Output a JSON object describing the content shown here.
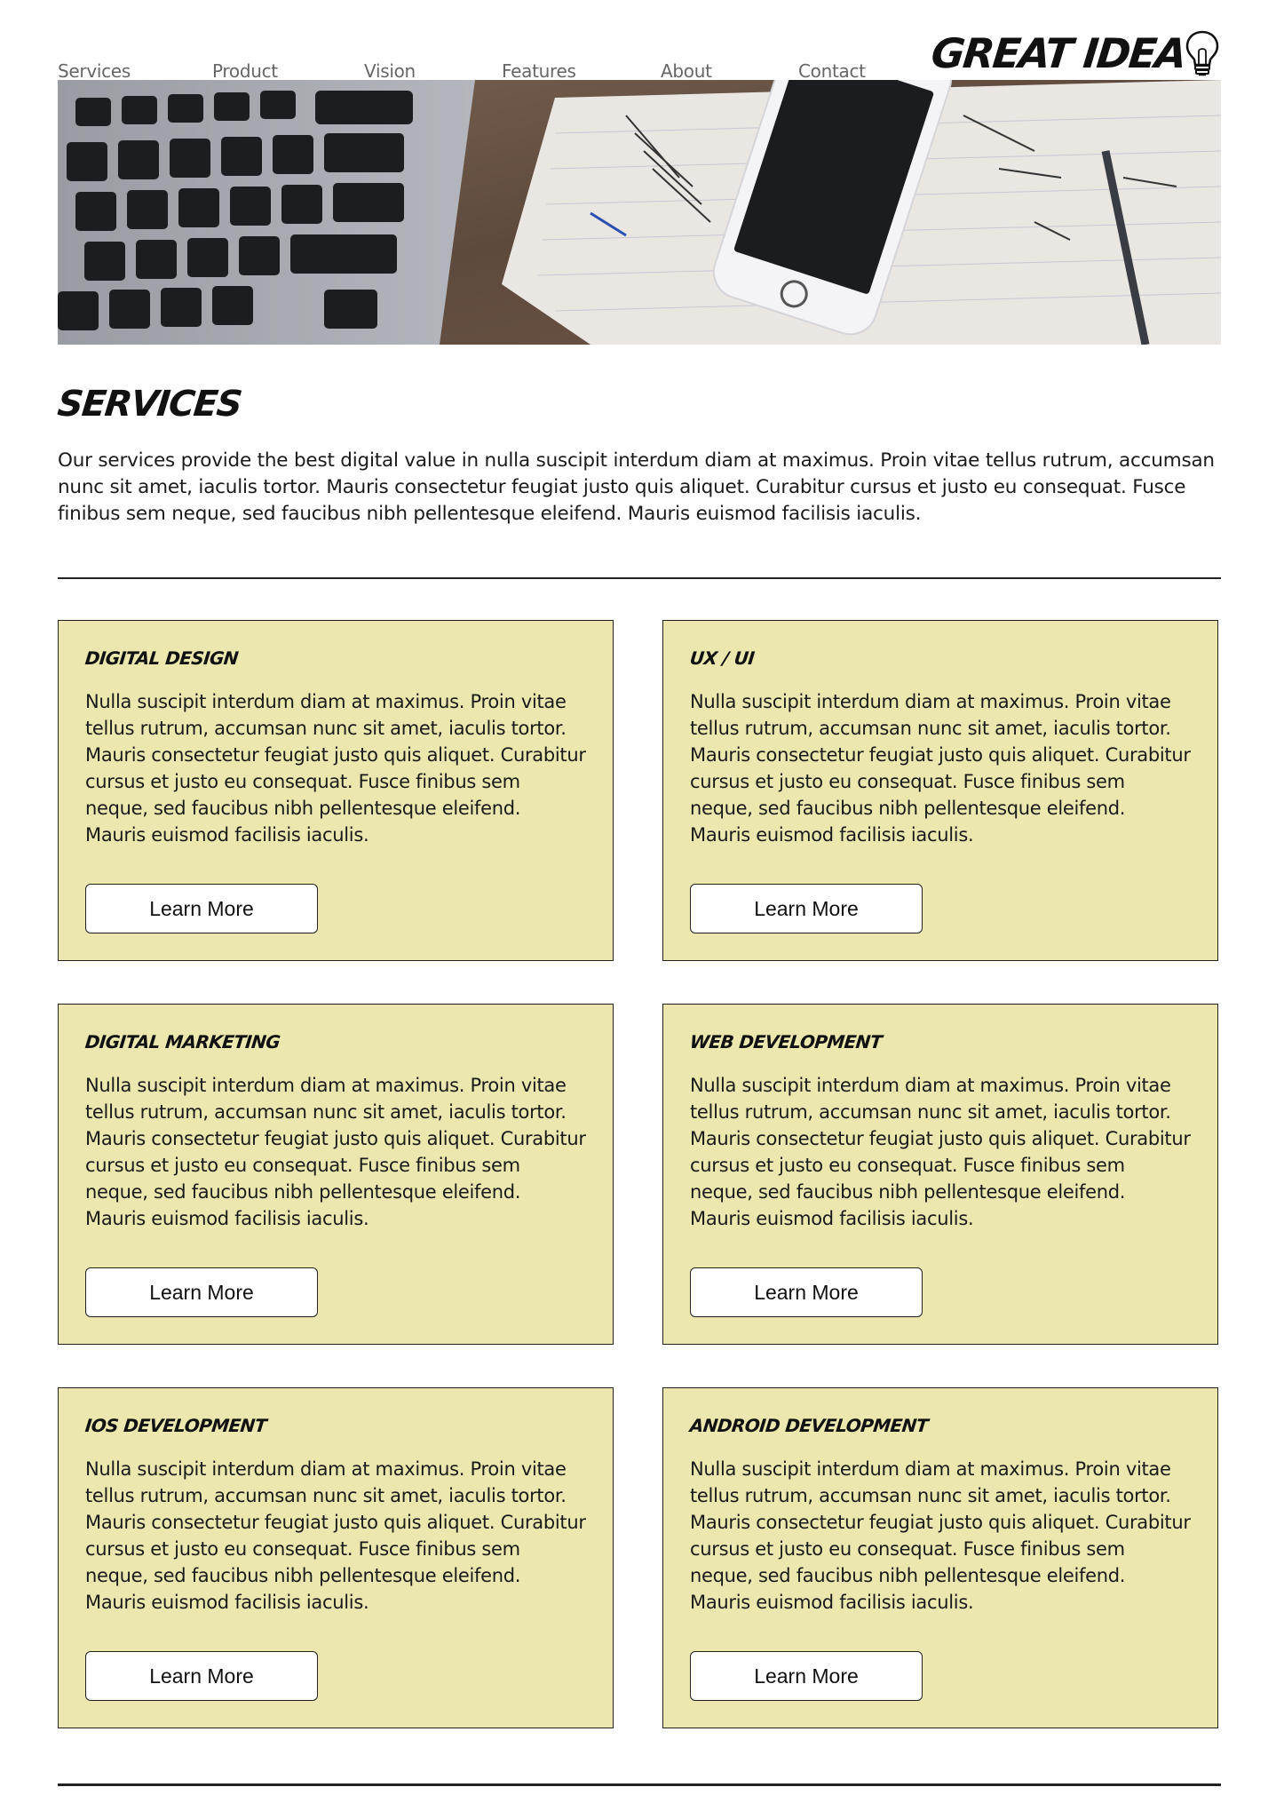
{
  "nav": {
    "items": [
      "Services",
      "Product",
      "Vision",
      "Features",
      "About",
      "Contact"
    ]
  },
  "logo": {
    "text": "GREAT IDEA",
    "icon": "lightbulb-icon"
  },
  "hero": {
    "image": "laptop keyboard, smartphone and handwritten notebook on wooden desk"
  },
  "services": {
    "title": "SERVICES",
    "intro": "Our services provide the best digital value in nulla suscipit interdum diam at maximus. Proin vitae tellus rutrum, accumsan nunc sit amet, iaculis tortor. Mauris consectetur feugiat justo quis aliquet. Curabitur cursus et justo eu consequat. Fusce finibus sem neque, sed faucibus nibh pellentesque eleifend. Mauris euismod facilisis iaculis.",
    "cards": [
      {
        "title": "Digital Design",
        "text": "Nulla suscipit interdum diam at maximus. Proin vitae tellus rutrum, accumsan nunc sit amet, iaculis tortor. Mauris consectetur feugiat justo quis aliquet. Curabitur cursus et justo eu consequat. Fusce finibus sem neque, sed faucibus nibh pellentesque eleifend. Mauris euismod facilisis iaculis.",
        "button": "Learn More"
      },
      {
        "title": "UX / UI",
        "text": "Nulla suscipit interdum diam at maximus. Proin vitae tellus rutrum, accumsan nunc sit amet, iaculis tortor. Mauris consectetur feugiat justo quis aliquet. Curabitur cursus et justo eu consequat. Fusce finibus sem neque, sed faucibus nibh pellentesque eleifend. Mauris euismod facilisis iaculis.",
        "button": "Learn More"
      },
      {
        "title": "Digital Marketing",
        "text": "Nulla suscipit interdum diam at maximus. Proin vitae tellus rutrum, accumsan nunc sit amet, iaculis tortor. Mauris consectetur feugiat justo quis aliquet. Curabitur cursus et justo eu consequat. Fusce finibus sem neque, sed faucibus nibh pellentesque eleifend. Mauris euismod facilisis iaculis.",
        "button": "Learn More"
      },
      {
        "title": "Web Development",
        "text": "Nulla suscipit interdum diam at maximus. Proin vitae tellus rutrum, accumsan nunc sit amet, iaculis tortor. Mauris consectetur feugiat justo quis aliquet. Curabitur cursus et justo eu consequat. Fusce finibus sem neque, sed faucibus nibh pellentesque eleifend. Mauris euismod facilisis iaculis.",
        "button": "Learn More"
      },
      {
        "title": "iOS Development",
        "text": "Nulla suscipit interdum diam at maximus. Proin vitae tellus rutrum, accumsan nunc sit amet, iaculis tortor. Mauris consectetur feugiat justo quis aliquet. Curabitur cursus et justo eu consequat. Fusce finibus sem neque, sed faucibus nibh pellentesque eleifend. Mauris euismod facilisis iaculis.",
        "button": "Learn More"
      },
      {
        "title": "Android Development",
        "text": "Nulla suscipit interdum diam at maximus. Proin vitae tellus rutrum, accumsan nunc sit amet, iaculis tortor. Mauris consectetur feugiat justo quis aliquet. Curabitur cursus et justo eu consequat. Fusce finibus sem neque, sed faucibus nibh pellentesque eleifend. Mauris euismod facilisis iaculis.",
        "button": "Learn More"
      }
    ]
  },
  "colors": {
    "card_bg": "#ece7ae",
    "border": "#222222",
    "nav_text": "#666666"
  }
}
